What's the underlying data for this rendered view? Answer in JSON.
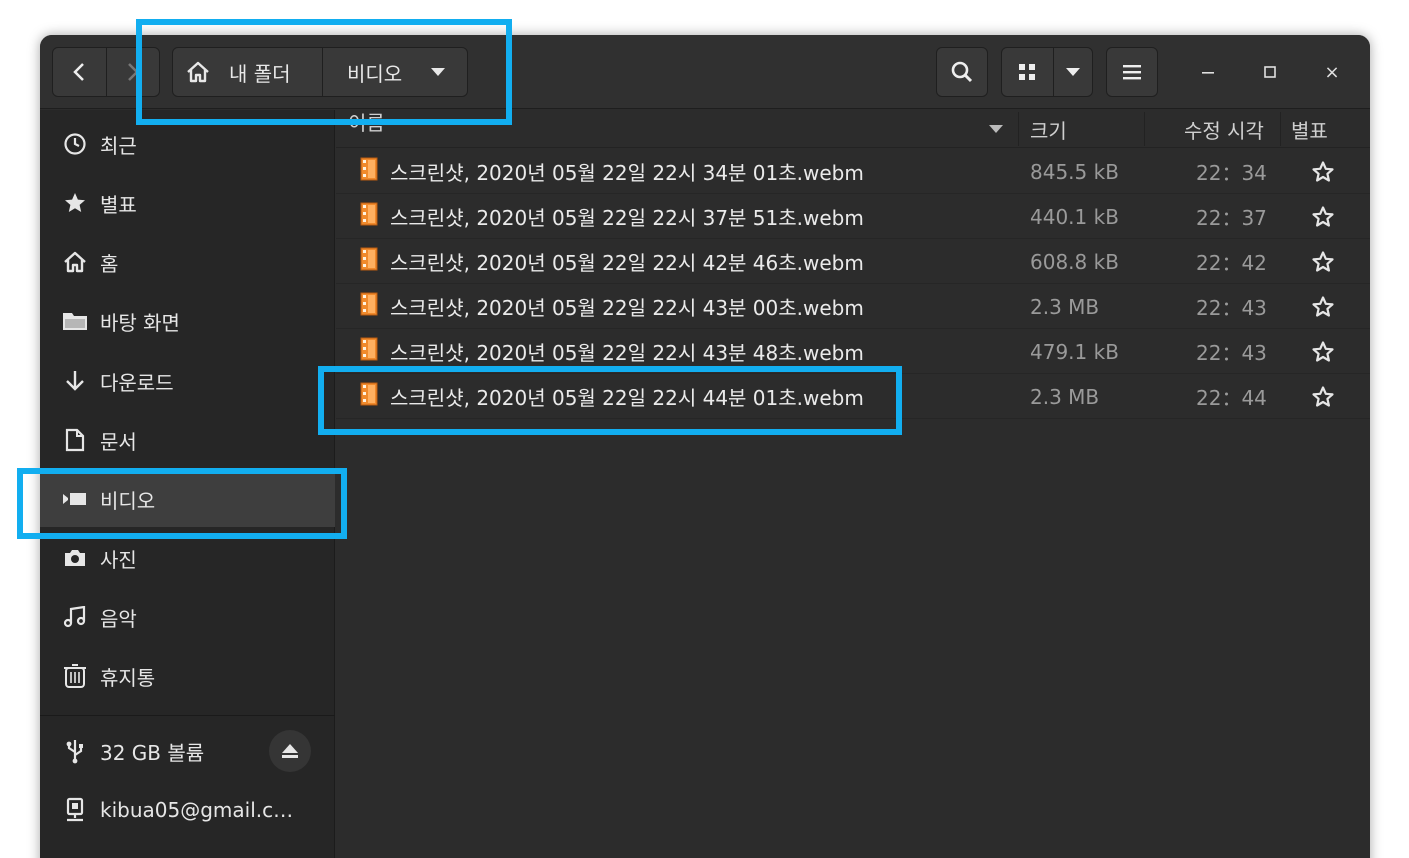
{
  "headerbar": {
    "path_home_label": "내 폴더",
    "path_current_label": "비디오",
    "nav_back_icon": "chevron-left-icon",
    "nav_forward_icon": "chevron-right-icon",
    "search_icon": "search-icon",
    "view_icon": "grid-icon",
    "menu_icon": "hamburger-menu-icon",
    "window_controls": [
      "minimize",
      "maximize",
      "close"
    ],
    "close_glyph": "×"
  },
  "sidebar": {
    "items": [
      {
        "label": "최근",
        "icon": "clock-icon"
      },
      {
        "label": "별표",
        "icon": "star-icon"
      },
      {
        "label": "홈",
        "icon": "home-icon"
      },
      {
        "label": "바탕 화면",
        "icon": "folder-icon"
      },
      {
        "label": "다운로드",
        "icon": "download-icon"
      },
      {
        "label": "문서",
        "icon": "document-icon"
      },
      {
        "label": "비디오",
        "icon": "video-icon",
        "active": true
      },
      {
        "label": "사진",
        "icon": "camera-icon"
      },
      {
        "label": "음악",
        "icon": "music-icon"
      },
      {
        "label": "휴지통",
        "icon": "trash-icon"
      }
    ],
    "devices": [
      {
        "label": "32 GB 볼륨",
        "icon": "usb-icon"
      },
      {
        "label": "kibua05@gmail.c…",
        "icon": "network-account-icon"
      }
    ]
  },
  "columns": {
    "name": "이름",
    "size": "크기",
    "modified": "수정 시각",
    "starred": "별표"
  },
  "files": [
    {
      "name": "스크린샷, 2020년 05월 22일 22시 34분 01초.webm",
      "size": "845.5 kB",
      "time": "22：34"
    },
    {
      "name": "스크린샷, 2020년 05월 22일 22시 37분 51초.webm",
      "size": "440.1 kB",
      "time": "22：37"
    },
    {
      "name": "스크린샷, 2020년 05월 22일 22시 42분 46초.webm",
      "size": "608.8 kB",
      "time": "22：42"
    },
    {
      "name": "스크린샷, 2020년 05월 22일 22시 43분 00초.webm",
      "size": "2.3 MB",
      "time": "22：43"
    },
    {
      "name": "스크린샷, 2020년 05월 22일 22시 43분 48초.webm",
      "size": "479.1 kB",
      "time": "22：43"
    },
    {
      "name": "스크린샷, 2020년 05월 22일 22시 44분 01초.webm",
      "size": "2.3 MB",
      "time": "22：44"
    }
  ],
  "colors": {
    "highlight": "#12aef0",
    "window_bg": "#2c2c2c",
    "sidebar_bg": "#262626",
    "file_icon": "#f08a2c"
  }
}
